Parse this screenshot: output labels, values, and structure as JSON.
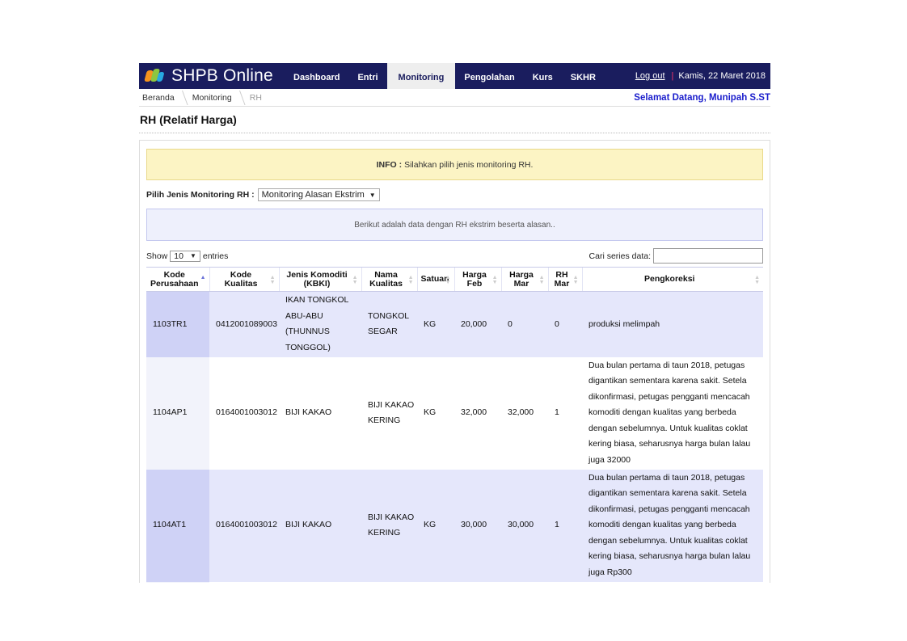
{
  "brand": {
    "name": "SHPB Online"
  },
  "nav": {
    "items": [
      {
        "label": "Dashboard",
        "active": false
      },
      {
        "label": "Entri",
        "active": false
      },
      {
        "label": "Monitoring",
        "active": true
      },
      {
        "label": "Pengolahan",
        "active": false
      },
      {
        "label": "Kurs",
        "active": false
      },
      {
        "label": "SKHR",
        "active": false
      }
    ],
    "logout": "Log out",
    "separator": "|",
    "date": "Kamis, 22 Maret 2018"
  },
  "breadcrumb": [
    "Beranda",
    "Monitoring",
    "RH"
  ],
  "welcome": "Selamat Datang, Munipah S.ST",
  "page_title": "RH (Relatif Harga)",
  "info": {
    "label": "INFO :",
    "text": "Silahkan pilih jenis monitoring RH."
  },
  "monitoring_select": {
    "label": "Pilih Jenis Monitoring RH :",
    "value": "Monitoring Alasan Ekstrim"
  },
  "notice": "Berikut adalah data dengan RH ekstrim beserta alasan..",
  "table_tools": {
    "show_label": "Show",
    "entries_value": "10",
    "entries_label": "entries",
    "search_label": "Cari series data:",
    "search_value": ""
  },
  "table": {
    "headers": [
      "Kode Perusahaan",
      "Kode Kualitas",
      "Jenis Komoditi (KBKI)",
      "Nama Kualitas",
      "Satuan",
      "Harga Feb",
      "Harga Mar",
      "RH Mar",
      "Pengkoreksi"
    ],
    "rows": [
      [
        "1103TR1",
        "0412001089003",
        "IKAN TONGKOL ABU-ABU (THUNNUS TONGGOL)",
        "TONGKOL SEGAR",
        "KG",
        "20,000",
        "0",
        "0",
        "produksi melimpah"
      ],
      [
        "1104AP1",
        "0164001003012",
        "BIJI KAKAO",
        "BIJI KAKAO KERING",
        "KG",
        "32,000",
        "32,000",
        "1",
        "Dua bulan pertama di taun 2018, petugas digantikan sementara karena sakit. Setela dikonfirmasi, petugas pengganti mencacah komoditi dengan kualitas yang berbeda dengan sebelumnya. Untuk kualitas coklat kering biasa, seharusnya harga bulan lalau juga 32000"
      ],
      [
        "1104AT1",
        "0164001003012",
        "BIJI KAKAO",
        "BIJI KAKAO KERING",
        "KG",
        "30,000",
        "30,000",
        "1",
        "Dua bulan pertama di taun 2018, petugas digantikan sementara karena sakit. Setela dikonfirmasi, petugas pengganti mencacah komoditi dengan kualitas yang berbeda dengan sebelumnya. Untuk kualitas coklat kering biasa, seharusnya harga bulan lalau juga Rp300"
      ],
      [
        "",
        "",
        "",
        "",
        "",
        "",
        "",
        "",
        ""
      ]
    ]
  },
  "colors": {
    "navbar": "#1a1d5e",
    "info_bg": "#fcf4c4",
    "row_odd": "#e5e7fb",
    "welcome": "#1a1dcc"
  }
}
